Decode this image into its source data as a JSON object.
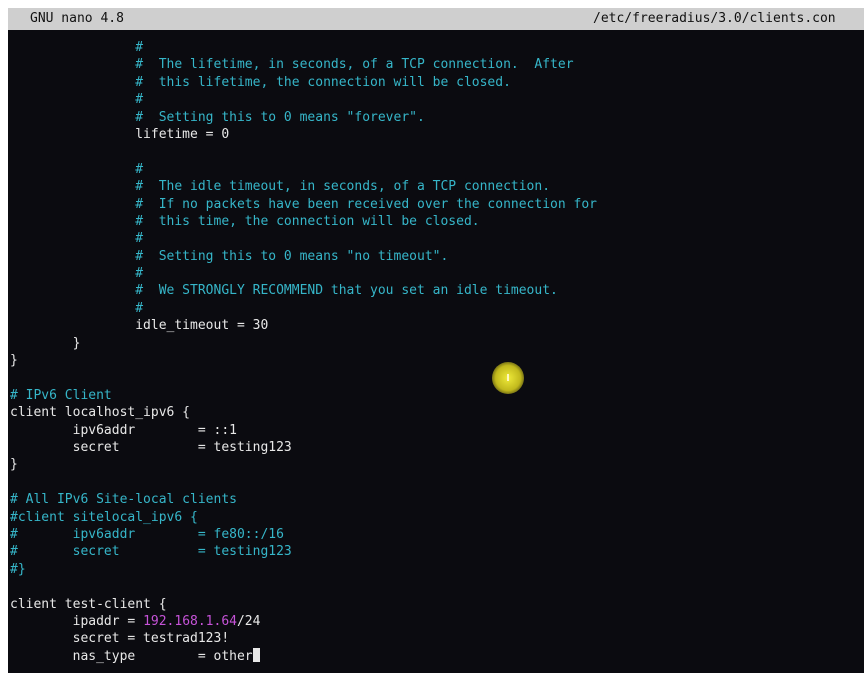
{
  "titlebar": {
    "app": "GNU nano 4.8",
    "file": "/etc/freeradius/3.0/clients.con"
  },
  "colors": {
    "comment": "#36b6c9",
    "ip_highlight": "#c653d8",
    "text": "#e8e8e8",
    "background": "#0b0b10"
  },
  "lines": [
    {
      "c": "                #"
    },
    {
      "c": "                #  The lifetime, in seconds, of a TCP connection.  After"
    },
    {
      "c": "                #  this lifetime, the connection will be closed."
    },
    {
      "c": "                #"
    },
    {
      "c": "                #  Setting this to 0 means \"forever\"."
    },
    {
      "t": "                lifetime = 0"
    },
    {
      "t": ""
    },
    {
      "c": "                #"
    },
    {
      "c": "                #  The idle timeout, in seconds, of a TCP connection."
    },
    {
      "c": "                #  If no packets have been received over the connection for"
    },
    {
      "c": "                #  this time, the connection will be closed."
    },
    {
      "c": "                #"
    },
    {
      "c": "                #  Setting this to 0 means \"no timeout\"."
    },
    {
      "c": "                #"
    },
    {
      "c": "                #  We STRONGLY RECOMMEND that you set an idle timeout."
    },
    {
      "c": "                #"
    },
    {
      "t": "                idle_timeout = 30"
    },
    {
      "t": "        }"
    },
    {
      "t": "}"
    },
    {
      "t": ""
    },
    {
      "c": "# IPv6 Client"
    },
    {
      "t": "client localhost_ipv6 {"
    },
    {
      "t": "        ipv6addr        = ::1"
    },
    {
      "t": "        secret          = testing123"
    },
    {
      "t": "}"
    },
    {
      "t": ""
    },
    {
      "c": "# All IPv6 Site-local clients"
    },
    {
      "c": "#client sitelocal_ipv6 {"
    },
    {
      "c": "#       ipv6addr        = fe80::/16"
    },
    {
      "c": "#       secret          = testing123"
    },
    {
      "c": "#}"
    },
    {
      "t": ""
    },
    {
      "t": "client test-client {"
    },
    {
      "pre": "        ipaddr = ",
      "ip": "192.168.1.64",
      "post": "/24"
    },
    {
      "t": "        secret = testrad123!"
    },
    {
      "t": "        nas_type        = other",
      "cursor": true
    }
  ]
}
